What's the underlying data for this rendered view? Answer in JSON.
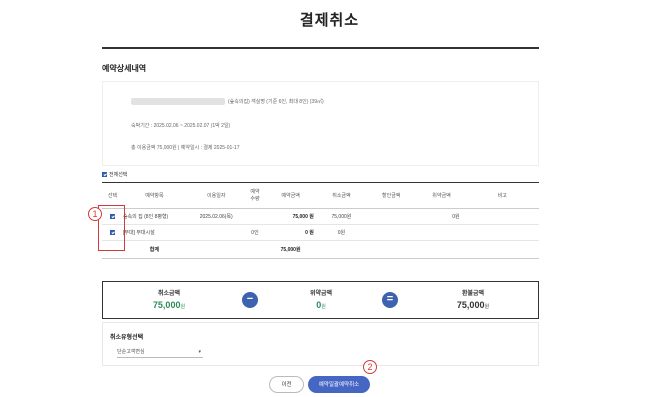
{
  "page": {
    "title": "결제취소"
  },
  "section": {
    "title": "예약상세내역"
  },
  "info": {
    "line1": "(숲속의집) 객실명 (기준 6인, 최대 8인) (39㎡)",
    "line2": "숙박기간 : 2025.02.06 ~ 2025.02.07 (1박 2일)",
    "line3": "총 이용금액 75,000원 | 예약일시 : 결제 2025-01-17"
  },
  "select_all": {
    "label": "전체선택"
  },
  "table": {
    "headers": [
      "선택",
      "예약항목",
      "이용일자",
      "예약\n수량",
      "예약금액",
      "취소금액",
      "할인금액",
      "위약금액",
      "비고"
    ],
    "rows": [
      {
        "item": "숲속의 집 (8인 8평형)",
        "date": "2025.02.06(목)",
        "qty": "",
        "amount": "75,000 원",
        "cancel": "75,000원",
        "discount": "",
        "penalty": "0원",
        "note": ""
      },
      {
        "item": "[부대] 부대시설",
        "date": "",
        "qty": "0인",
        "amount": "0 원",
        "cancel": "0원",
        "discount": "",
        "penalty": "",
        "note": ""
      }
    ],
    "total": {
      "label": "합계",
      "amount": "75,000원"
    }
  },
  "markers": {
    "one": "1",
    "two": "2"
  },
  "summary": {
    "cancel": {
      "label": "취소금액",
      "value": "75,000",
      "unit": "원"
    },
    "penalty": {
      "label": "위약금액",
      "value": "0",
      "unit": "원"
    },
    "refund": {
      "label": "환불금액",
      "value": "75,000",
      "unit": "원"
    },
    "minus": "−",
    "equals": "="
  },
  "cancel_type": {
    "label": "취소유형선택",
    "selected": "단순고객변심"
  },
  "buttons": {
    "prev": "이전",
    "confirm": "예약일괄예약취소"
  },
  "colors": {
    "accent": "#3c62b0",
    "positive": "#2e8b57",
    "highlight": "#d43a3a"
  }
}
